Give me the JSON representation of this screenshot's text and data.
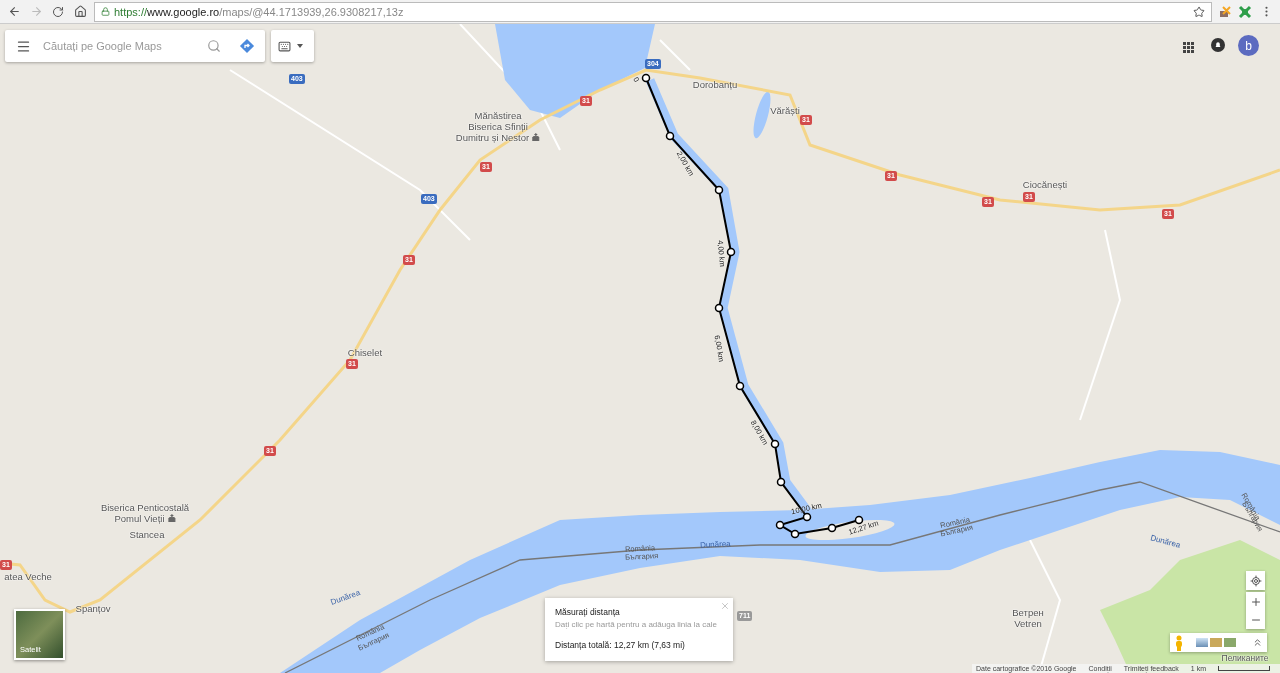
{
  "browser": {
    "url": {
      "scheme": "https://",
      "host": "www.google.ro",
      "path": "/maps/@44.1713939,26.9308217,13z"
    }
  },
  "search": {
    "placeholder": "Căutați pe Google Maps"
  },
  "account": {
    "avatar_letter": "b"
  },
  "map": {
    "places": [
      {
        "lines": [
          "Mănăstirea",
          "Biserica Sfinții",
          "Dumitru și Nestor"
        ],
        "poi": true
      },
      {
        "lines": [
          "Dorobanțu"
        ],
        "poi": false
      },
      {
        "lines": [
          "Vărăști"
        ],
        "poi": false
      },
      {
        "lines": [
          "Ciocănești"
        ],
        "poi": false
      },
      {
        "lines": [
          "Chiselet"
        ],
        "poi": false
      },
      {
        "lines": [
          "Biserica Penticostală",
          "Pomul Vieții"
        ],
        "poi": true
      },
      {
        "lines": [
          "Stancea"
        ],
        "poi": false
      },
      {
        "lines": [
          "Spanțov"
        ],
        "poi": false
      },
      {
        "lines": [
          "atea Veche"
        ],
        "poi": false
      },
      {
        "lines": [
          "Ветрен",
          "Vetren"
        ],
        "poi": false
      },
      {
        "lines": [
          "Пеликаните"
        ],
        "poi": false
      }
    ],
    "road_shields": [
      {
        "text": "304",
        "kind": "national"
      },
      {
        "text": "403",
        "kind": "national"
      },
      {
        "text": "403",
        "kind": "national"
      },
      {
        "text": "31",
        "kind": "main"
      },
      {
        "text": "31",
        "kind": "main"
      },
      {
        "text": "31",
        "kind": "main"
      },
      {
        "text": "31",
        "kind": "main"
      },
      {
        "text": "31",
        "kind": "main"
      },
      {
        "text": "31",
        "kind": "main"
      },
      {
        "text": "31",
        "kind": "main"
      },
      {
        "text": "31",
        "kind": "main"
      },
      {
        "text": "31",
        "kind": "main"
      },
      {
        "text": "31",
        "kind": "main"
      },
      {
        "text": "31",
        "kind": "main"
      },
      {
        "text": "711",
        "kind": "local"
      }
    ],
    "river_labels": [
      "Dunărea",
      "Dunărea",
      "Dunărea"
    ],
    "border_labels": [
      "România",
      "България",
      "România",
      "България",
      "România",
      "България",
      "România",
      "България"
    ],
    "measure_labels": [
      "0",
      "2,00 km",
      "4,00 km",
      "6,00 km",
      "8,00 km",
      "10,00 km",
      "12,27 km"
    ]
  },
  "measure_card": {
    "title": "Măsurați distanța",
    "hint": "Dați clic pe hartă pentru a adăuga linia la cale",
    "total": "Distanța totală: 12,27 km (7,63 mi)"
  },
  "layer_switcher": {
    "label": "Satelit"
  },
  "footer": {
    "items": [
      "Date cartografice ©2016 Google",
      "Condiții",
      "Trimiteți feedback"
    ],
    "scale": "1 km"
  }
}
